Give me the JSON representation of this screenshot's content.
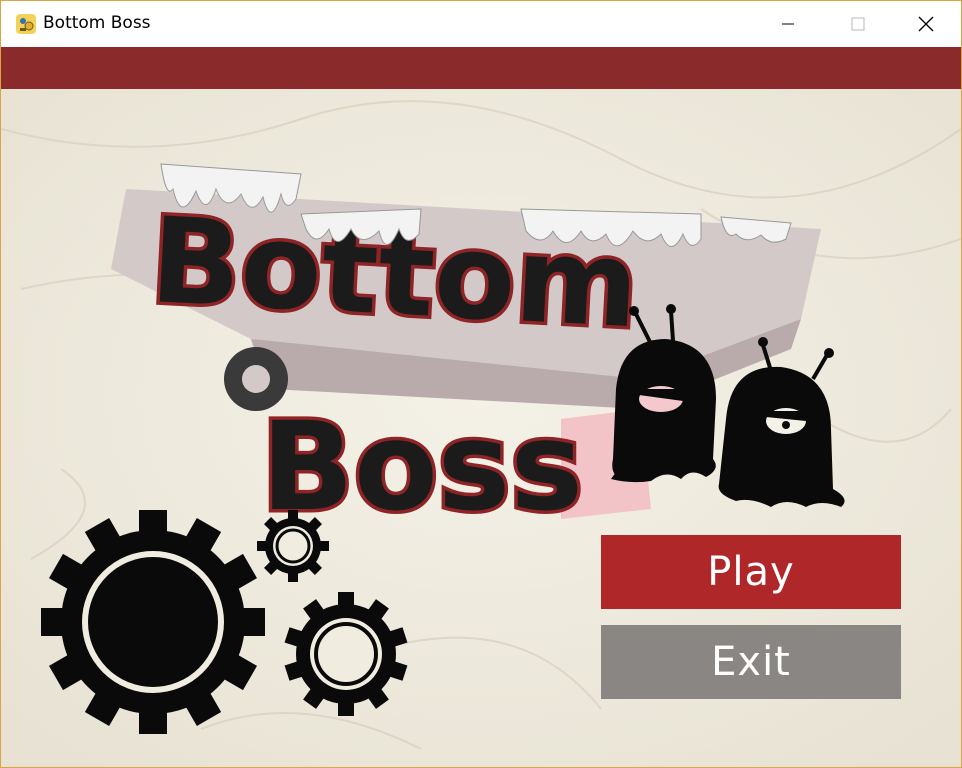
{
  "window": {
    "title": "Bottom Boss",
    "icon": "pygame-snake-icon",
    "controls": [
      "minimize-icon",
      "maximize-icon",
      "close-icon"
    ]
  },
  "colors": {
    "accent_bar": "#8b2a2a",
    "background": "#f0ece0",
    "play_button": "#b0272a",
    "exit_button": "#8a8683",
    "logo_fill": "#1b1b1b",
    "logo_outline": "#8e2426"
  },
  "logo": {
    "line1": "Bottom",
    "line2": "Boss"
  },
  "menu": {
    "play_label": "Play",
    "exit_label": "Exit"
  }
}
